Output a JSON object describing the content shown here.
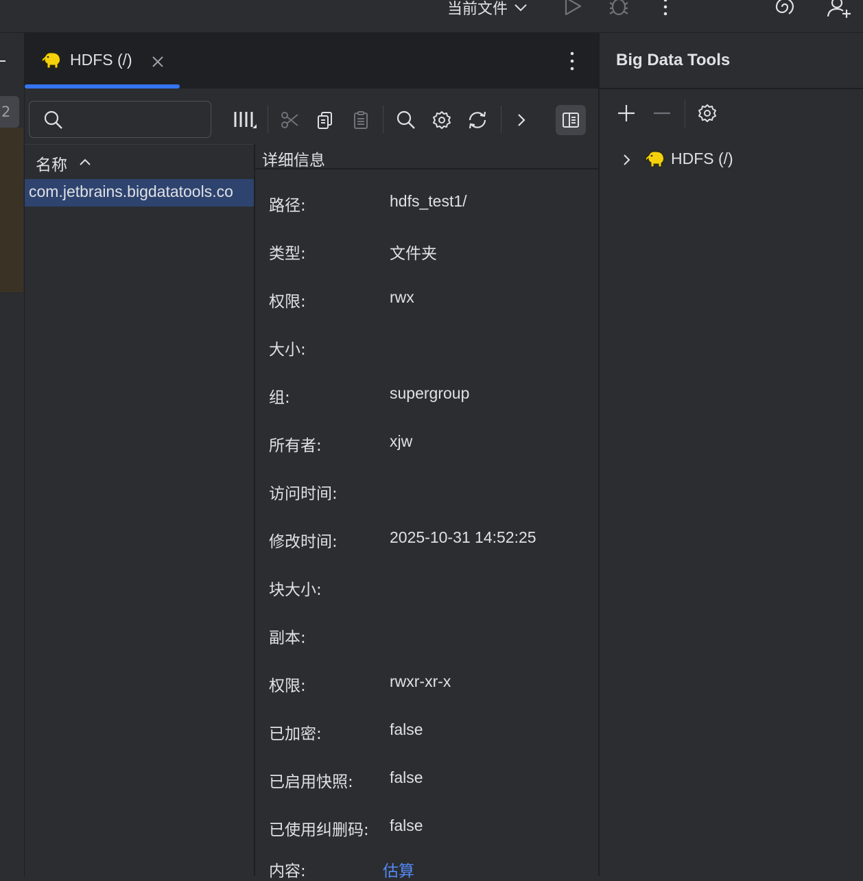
{
  "toolbar": {
    "run_config_label": "当前文件"
  },
  "left_strip": {
    "badge": "2"
  },
  "editor_tab": {
    "label": "HDFS (/)"
  },
  "file_browser": {
    "search_placeholder": "",
    "column_name_header": "名称",
    "rows": [
      "com.jetbrains.bigdatatools.co"
    ]
  },
  "details": {
    "header": "详细信息",
    "fields": [
      {
        "label": "路径:",
        "value": "hdfs_test1/"
      },
      {
        "label": "类型:",
        "value": "文件夹"
      },
      {
        "label": "权限:",
        "value": "rwx"
      },
      {
        "label": "大小:",
        "value": ""
      },
      {
        "label": "组:",
        "value": "supergroup"
      },
      {
        "label": "所有者:",
        "value": "xjw"
      },
      {
        "label": "访问时间:",
        "value": ""
      },
      {
        "label": "修改时间:",
        "value": "2025-10-31 14:52:25"
      },
      {
        "label": "块大小:",
        "value": ""
      },
      {
        "label": "副本:",
        "value": ""
      },
      {
        "label": "权限:",
        "value": "rwxr-xr-x"
      },
      {
        "label": "已加密:",
        "value": "false"
      },
      {
        "label": "已启用快照:",
        "value": "false"
      },
      {
        "label": "已使用纠删码:",
        "value": "false"
      },
      {
        "label": "内容:",
        "value": "估算"
      }
    ]
  },
  "big_data_tools": {
    "title": "Big Data Tools",
    "tree": [
      {
        "label": "HDFS (/)"
      }
    ]
  },
  "icons": {
    "hdfs": "hadoop-elephant-icon",
    "accent": "#3574f0",
    "elephant_color": "#f5d10c",
    "link_color": "#548af7",
    "selection_color": "#2e436e"
  }
}
